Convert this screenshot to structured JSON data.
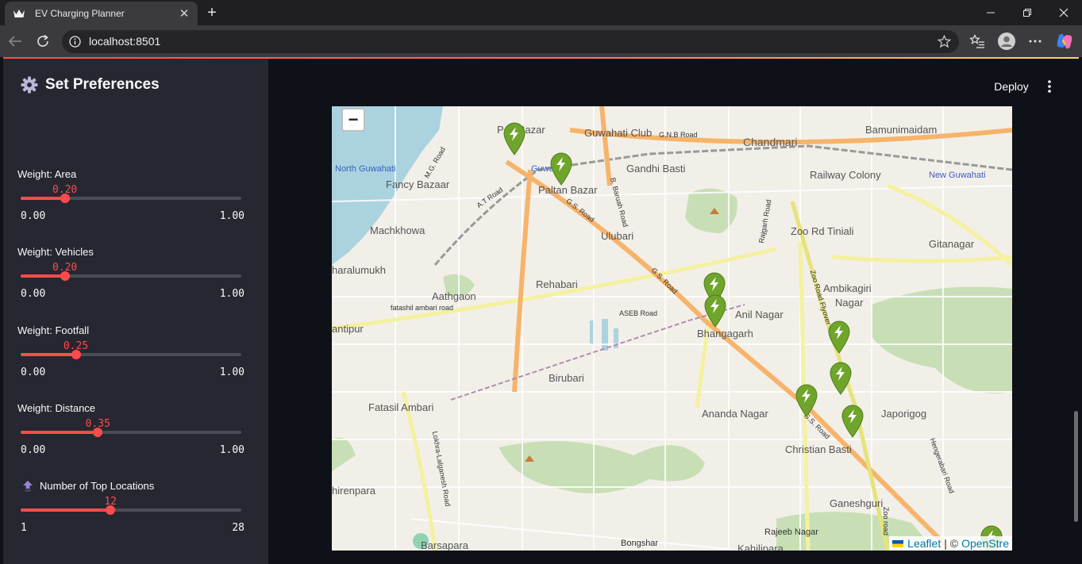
{
  "browser": {
    "tab_title": "EV Charging Planner",
    "url": "localhost:8501"
  },
  "sidebar": {
    "title": "Set Preferences",
    "sliders": [
      {
        "label": "Weight: Area",
        "value": "0.20",
        "min": "0.00",
        "max": "1.00",
        "fraction": 0.2
      },
      {
        "label": "Weight: Vehicles",
        "value": "0.20",
        "min": "0.00",
        "max": "1.00",
        "fraction": 0.2
      },
      {
        "label": "Weight: Footfall",
        "value": "0.25",
        "min": "0.00",
        "max": "1.00",
        "fraction": 0.25
      },
      {
        "label": "Weight: Distance",
        "value": "0.35",
        "min": "0.00",
        "max": "1.00",
        "fraction": 0.35
      },
      {
        "label": "Number of Top Locations",
        "value": "12",
        "min": "1",
        "max": "28",
        "fraction": 0.407
      }
    ]
  },
  "header": {
    "deploy_label": "Deploy"
  },
  "map": {
    "zoom_out_label": "−",
    "places": {
      "pan_bazar": "Pan Bazar",
      "guwahati_club": "Guwahati Club",
      "gnb_road": "G.N.B Road",
      "chandmari": "Chandmari",
      "bamunimaidam": "Bamunimaidam",
      "north_guwahati": "North Guwahati",
      "mg_road": "M.G. Road",
      "fancy_bazaar": "Fancy Bazaar",
      "guwahati_station": "Guwa",
      "paltan_bazar": "Paltan Bazar",
      "gandhi_basti": "Gandhi Basti",
      "railway_colony": "Railway Colony",
      "new_guwahati": "New Guwahati",
      "at_road": "A.T Road",
      "gs_road": "G.S. Road",
      "b_baruah_road": "B. Baruah Road",
      "rajgarh_road": "Rajgarh Road",
      "machkhowa": "Machkhowa",
      "ulubari": "Ulubari",
      "zoo_rd_tiniali": "Zoo Rd Tiniali",
      "gitanagar": "Gitanagar",
      "bharalumukh": "haralumukh",
      "rehabari": "Rehabari",
      "zoo_road_flyover": "Zoo Road Flyover",
      "ambikagiri_nagar_1": "Ambikagiri",
      "ambikagiri_nagar_2": "Nagar",
      "aathgaon": "Aathgaon",
      "fatasil_ambari_road": "fatashil ambari road",
      "aseb_road": "ASEB Road",
      "anil_nagar": "Anil Nagar",
      "antipur": "antipur",
      "bhangagarh": "Bhangagarh",
      "birubari": "Birubari",
      "fatasil_ambari": "Fatasil Ambari",
      "ananda_nagar": "Ananda Nagar",
      "japorigog": "Japorigog",
      "lokhra_road": "Lokhra-Lalganesh Road",
      "christian_basti": "Christian Basti",
      "hengerabari_road": "Hengerabari Road",
      "dhirenpara": "hirenpara",
      "ganeshguri": "Ganeshguri",
      "zoo_road": "Zoo road",
      "rajeeb_nagar": "Rajeeb Nagar",
      "barsapara": "Barsapara",
      "bongshar": "Bongshar",
      "kahilipara": "Kahilipara"
    },
    "attribution": {
      "leaflet": "Leaflet",
      "separator": "| ©",
      "osm": "OpenStre"
    }
  },
  "colors": {
    "accent": "#ff4b4b",
    "sidebar_bg": "#262730",
    "app_bg": "#0e1117",
    "marker_green": "#6fa52a"
  }
}
